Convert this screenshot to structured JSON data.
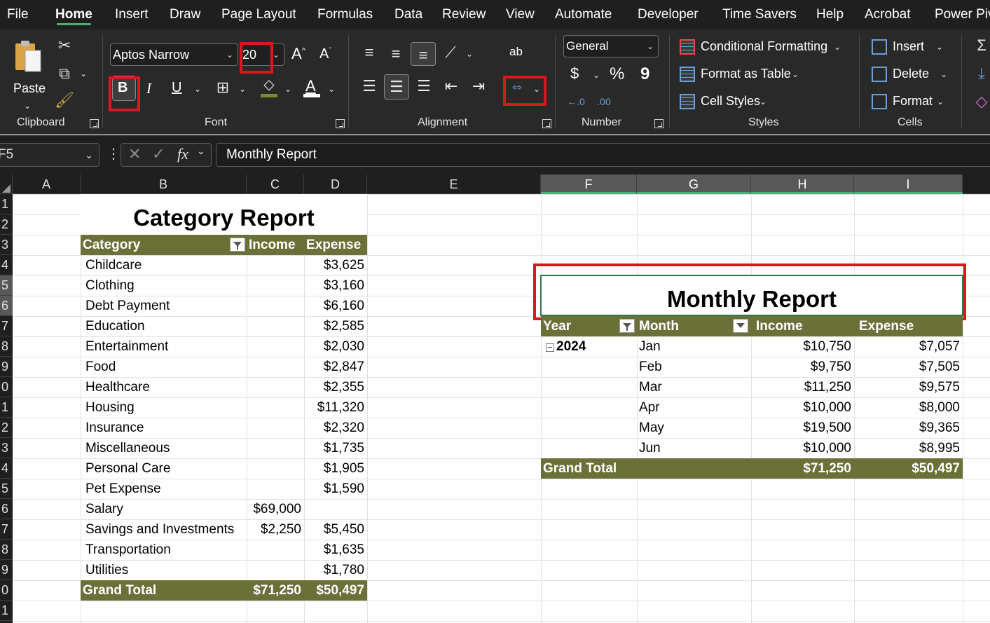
{
  "menu": {
    "tabs": [
      "File",
      "Home",
      "Insert",
      "Draw",
      "Page Layout",
      "Formulas",
      "Data",
      "Review",
      "View",
      "Automate",
      "Developer",
      "Time Savers",
      "Help",
      "Acrobat",
      "Power Piv"
    ],
    "active": "Home"
  },
  "ribbon": {
    "clipboard": {
      "paste_label": "Paste",
      "group_label": "Clipboard"
    },
    "font": {
      "font_name": "Aptos Narrow",
      "font_size": "20",
      "bold": "B",
      "italic": "I",
      "underline": "U",
      "font_color_letter": "A",
      "grow_letter": "A",
      "shrink_letter": "A",
      "group_label": "Font",
      "fill_color": "#7a8a2e",
      "font_color_bar": "#ffffff"
    },
    "alignment": {
      "group_label": "Alignment",
      "wrap_text_icon": "ab"
    },
    "number": {
      "format": "General",
      "currency": "$",
      "percent": "%",
      "comma": "9",
      "inc_decimal": "←.0\n.00",
      "dec_decimal": ".00\n→.0",
      "group_label": "Number"
    },
    "styles": {
      "conditional_formatting": "Conditional Formatting",
      "format_as_table": "Format as Table",
      "cell_styles": "Cell Styles",
      "group_label": "Styles"
    },
    "cells": {
      "insert": "Insert",
      "delete": "Delete",
      "format": "Format",
      "group_label": "Cells"
    }
  },
  "formula_bar": {
    "name_box": "F5",
    "fx": "fx",
    "content": "Monthly Report"
  },
  "columns": [
    "A",
    "B",
    "C",
    "D",
    "E",
    "F",
    "G",
    "H",
    "I"
  ],
  "selected_columns": [
    "F",
    "G",
    "H",
    "I"
  ],
  "rows": [
    "1",
    "2",
    "3",
    "4",
    "5",
    "6",
    "7",
    "8",
    "9",
    "0",
    "1",
    "2",
    "3",
    "4",
    "5",
    "6",
    "7",
    "8",
    "9",
    "0",
    "1"
  ],
  "category_report": {
    "title": "Category Report",
    "headers": {
      "category": "Category",
      "income": "Income",
      "expense": "Expense"
    },
    "rows": [
      {
        "category": "Childcare",
        "income": "",
        "expense": "$3,625"
      },
      {
        "category": "Clothing",
        "income": "",
        "expense": "$3,160"
      },
      {
        "category": "Debt Payment",
        "income": "",
        "expense": "$6,160"
      },
      {
        "category": "Education",
        "income": "",
        "expense": "$2,585"
      },
      {
        "category": "Entertainment",
        "income": "",
        "expense": "$2,030"
      },
      {
        "category": "Food",
        "income": "",
        "expense": "$2,847"
      },
      {
        "category": "Healthcare",
        "income": "",
        "expense": "$2,355"
      },
      {
        "category": "Housing",
        "income": "",
        "expense": "$11,320"
      },
      {
        "category": "Insurance",
        "income": "",
        "expense": "$2,320"
      },
      {
        "category": "Miscellaneous",
        "income": "",
        "expense": "$1,735"
      },
      {
        "category": "Personal Care",
        "income": "",
        "expense": "$1,905"
      },
      {
        "category": "Pet Expense",
        "income": "",
        "expense": "$1,590"
      },
      {
        "category": "Salary",
        "income": "$69,000",
        "expense": ""
      },
      {
        "category": "Savings and Investments",
        "income": "$2,250",
        "expense": "$5,450"
      },
      {
        "category": "Transportation",
        "income": "",
        "expense": "$1,635"
      },
      {
        "category": "Utilities",
        "income": "",
        "expense": "$1,780"
      }
    ],
    "total": {
      "label": "Grand Total",
      "income": "$71,250",
      "expense": "$50,497"
    }
  },
  "monthly_report": {
    "title": "Monthly Report",
    "headers": {
      "year": "Year",
      "month": "Month",
      "income": "Income",
      "expense": "Expense"
    },
    "year": "2024",
    "rows": [
      {
        "month": "Jan",
        "income": "$10,750",
        "expense": "$7,057"
      },
      {
        "month": "Feb",
        "income": "$9,750",
        "expense": "$7,505"
      },
      {
        "month": "Mar",
        "income": "$11,250",
        "expense": "$9,575"
      },
      {
        "month": "Apr",
        "income": "$10,000",
        "expense": "$8,000"
      },
      {
        "month": "May",
        "income": "$19,500",
        "expense": "$9,365"
      },
      {
        "month": "Jun",
        "income": "$10,000",
        "expense": "$8,995"
      }
    ],
    "total": {
      "label": "Grand Total",
      "income": "$71,250",
      "expense": "$50,497"
    }
  },
  "colors": {
    "table_header": "#6b7039",
    "highlight": "#e0141e",
    "selection": "#2f7a4a"
  }
}
